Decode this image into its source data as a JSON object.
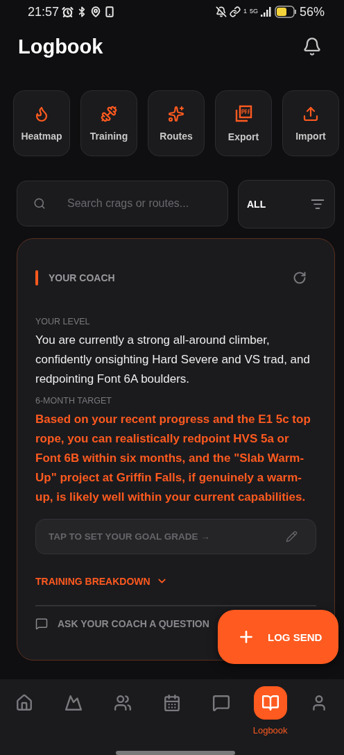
{
  "status_bar": {
    "time": "21:57",
    "sim": "1",
    "network": "5G",
    "battery": "56%"
  },
  "header": {
    "title": "Logbook"
  },
  "quick_actions": [
    {
      "label": "Heatmap"
    },
    {
      "label": "Training"
    },
    {
      "label": "Routes"
    },
    {
      "label": "Export"
    },
    {
      "label": "Import"
    }
  ],
  "search": {
    "placeholder": "Search crags or routes..."
  },
  "filter": {
    "value": "ALL"
  },
  "coach": {
    "title": "YOUR COACH",
    "level_label": "YOUR LEVEL",
    "level_text": "You are currently a strong all-around climber, confidently onsighting Hard Severe and VS trad, and redpointing Font 6A boulders.",
    "target_label": "6-MONTH TARGET",
    "target_text": "Based on your recent progress and the E1 5c top rope, you can realistically redpoint HVS 5a or Font 6B within six months, and the \"Slab Warm-Up\" project at Griffin Falls, if genuinely a warm-up, is likely well within your current capabilities.",
    "goal_placeholder": "TAP TO SET YOUR GOAL GRADE →",
    "breakdown": {
      "label": "TRAINING BREAKDOWN",
      "expanded": false
    },
    "ask": "ASK YOUR COACH A QUESTION"
  },
  "fab": {
    "label": "LOG SEND"
  },
  "nav": [
    {
      "selected": false
    },
    {
      "selected": false
    },
    {
      "selected": false
    },
    {
      "selected": false
    },
    {
      "selected": false
    },
    {
      "label": "Logbook",
      "selected": true
    },
    {
      "selected": false
    }
  ]
}
